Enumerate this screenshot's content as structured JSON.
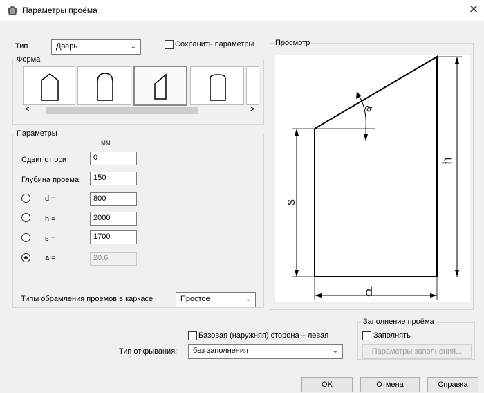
{
  "window": {
    "title": "Параметры проёма",
    "close_glyph": "✕"
  },
  "type_row": {
    "label": "Тип",
    "value": "Дверь",
    "save_params_label": "Сохранить параметры",
    "save_params_checked": false
  },
  "form_group": {
    "legend": "Форма",
    "shapes": [
      "arched-door",
      "semi-arch-door",
      "sloped-door",
      "flat-arch-door"
    ],
    "selected_index": 2,
    "scroll_left": "<",
    "scroll_right": ">"
  },
  "params": {
    "legend": "Параметры",
    "unit": "мм",
    "axis_offset_label": "Сдвиг от оси",
    "axis_offset_value": "0",
    "depth_label": "Глубина проема",
    "depth_value": "150",
    "d_label": "d =",
    "d_value": "800",
    "h_label": "h =",
    "h_value": "2000",
    "s_label": "s =",
    "s_value": "1700",
    "a_label": "a =",
    "a_value": "20.6",
    "selected_param": "a"
  },
  "framing": {
    "label": "Типы обрамления проемов в каркасе",
    "value": "Простое"
  },
  "preview": {
    "legend": "Просмотр",
    "label_d": "d",
    "label_h": "h",
    "label_s": "s",
    "label_a": "a"
  },
  "opening": {
    "base_side_label": "Базовая (наружняя) сторона – левая",
    "base_side_checked": false,
    "type_label": "Тип открывания:",
    "type_value": "без заполнения"
  },
  "fill": {
    "legend": "Заполнение проёма",
    "fill_label": "Заполнять",
    "fill_checked": false,
    "fill_params_button": "Параметры заполнения..."
  },
  "buttons": {
    "ok": "OK",
    "cancel": "Отмена",
    "help": "Справка"
  }
}
